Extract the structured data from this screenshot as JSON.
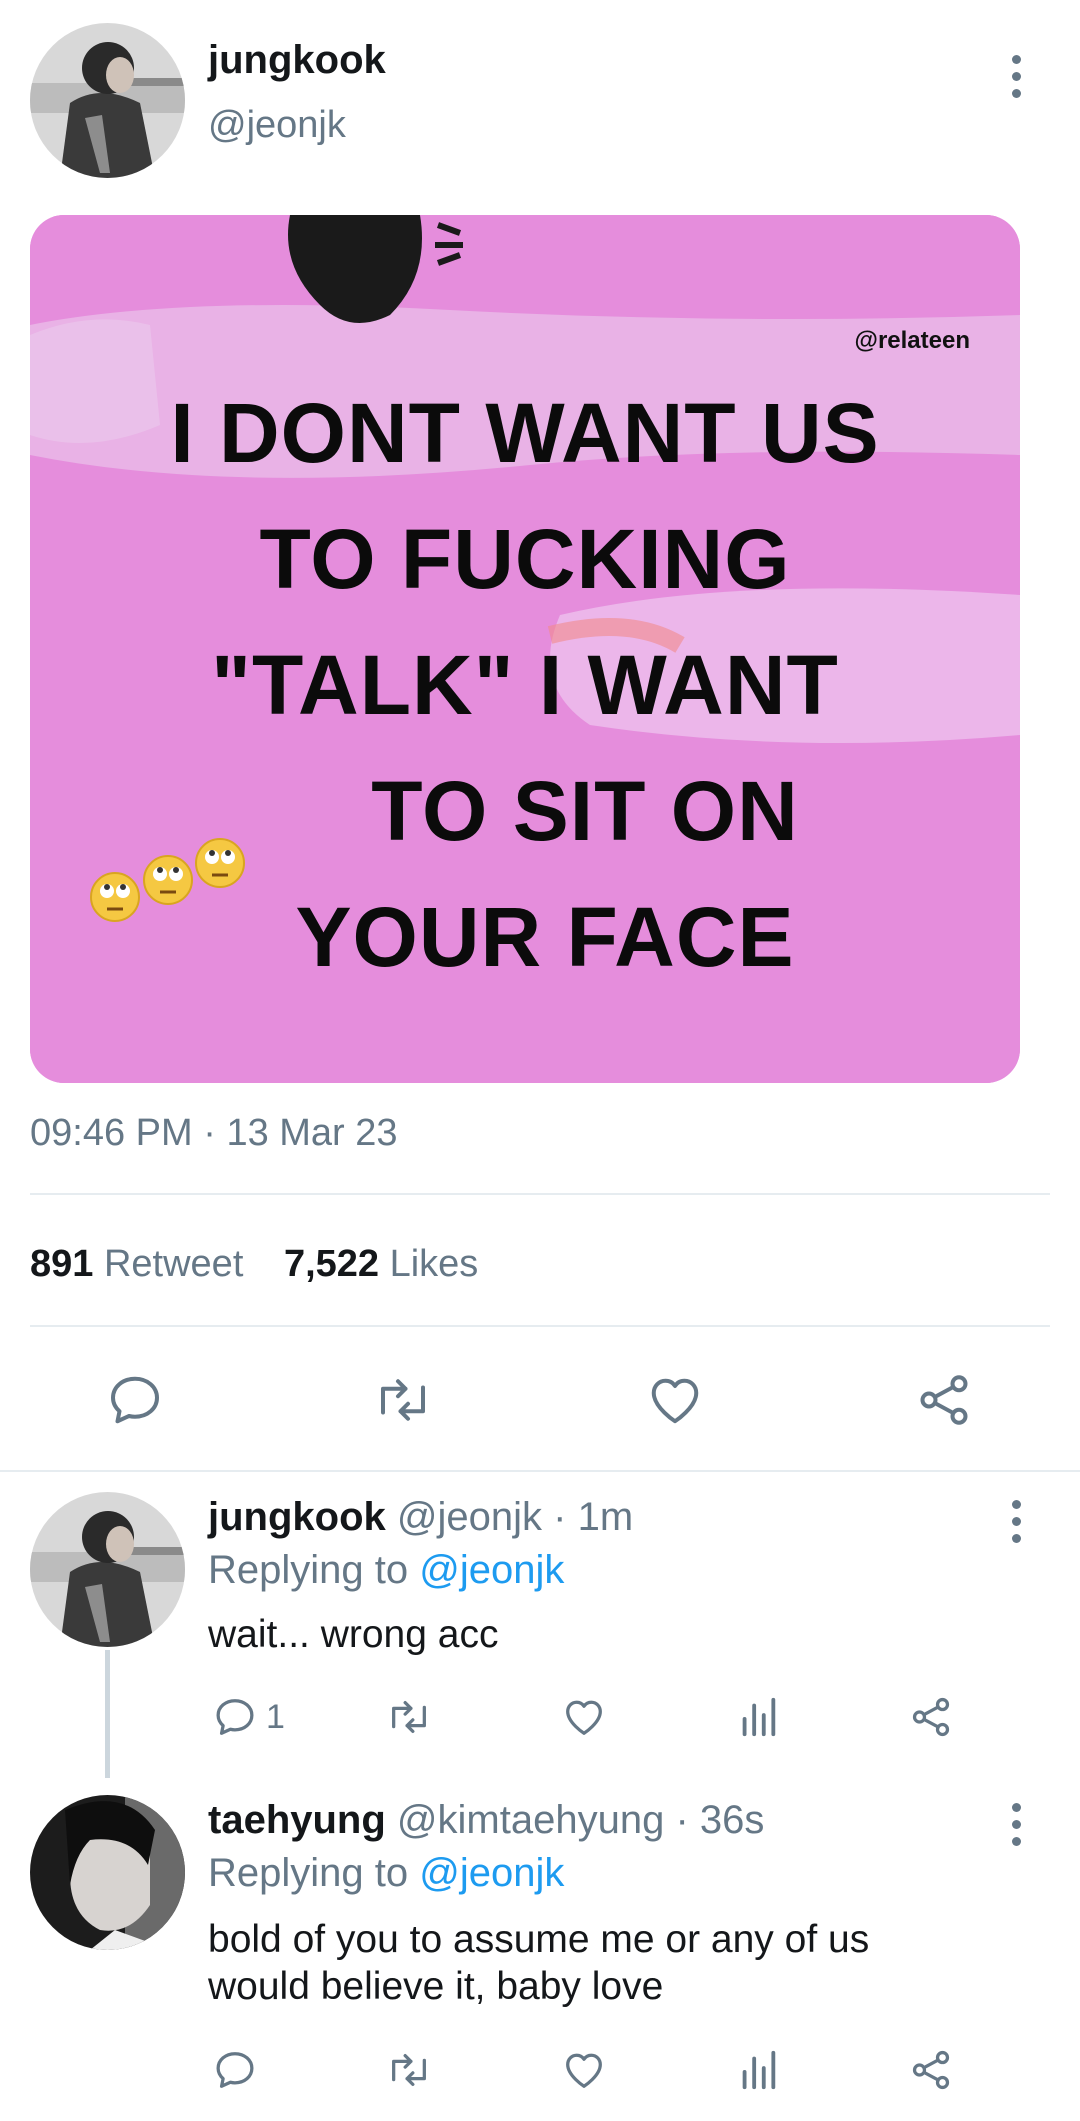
{
  "tweet": {
    "display_name": "jungkook",
    "handle": "@jeonjk",
    "image": {
      "watermark": "@relateen",
      "lines": [
        "I DONT WANT US",
        "TO FUCKING",
        "\"TALK\" I WANT",
        "TO SIT ON",
        "YOUR FACE"
      ],
      "emoji": "rolling-eyes-emoji"
    },
    "time": "09:46 PM",
    "separator": "·",
    "date": "13 Mar 23",
    "retweet_count": "891",
    "retweet_label": "Retweet",
    "likes_count": "7,522",
    "likes_label": "Likes"
  },
  "replies": [
    {
      "display_name": "jungkook",
      "handle": "@jeonjk",
      "time": "· 1m",
      "replying_prefix": "Replying to",
      "replying_to": "@jeonjk",
      "text": "wait... wrong acc",
      "reply_count": "1"
    },
    {
      "display_name": "taehyung",
      "handle": "@kimtaehyung",
      "time": "· 36s",
      "replying_prefix": "Replying to",
      "replying_to": "@jeonjk",
      "text_line1": "bold of you to assume me or any of us",
      "text_line2": "would believe it, baby love",
      "reply_count": ""
    }
  ],
  "colors": {
    "accent": "#1d9bf0",
    "secondary_text": "#657786",
    "meme_background": "#e58ddc"
  }
}
